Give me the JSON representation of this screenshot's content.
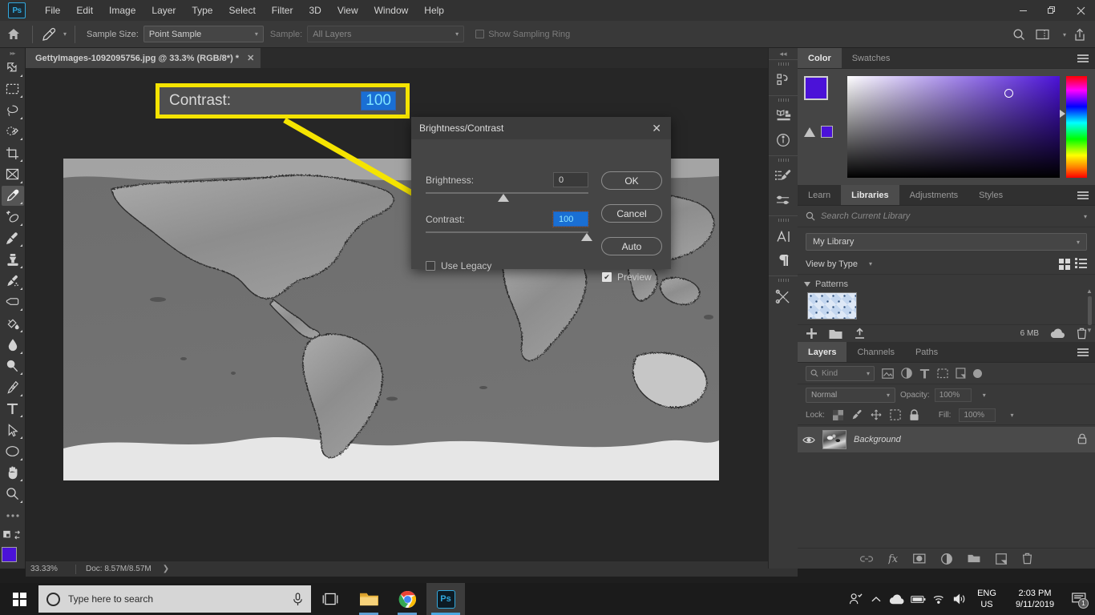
{
  "app": {
    "logo": "Ps",
    "menus": [
      "File",
      "Edit",
      "Image",
      "Layer",
      "Type",
      "Select",
      "Filter",
      "3D",
      "View",
      "Window",
      "Help"
    ],
    "window_controls": {
      "minimize": "—",
      "restore": "❐",
      "close": "✕"
    }
  },
  "options_bar": {
    "home_icon": "home-icon",
    "tool_icon": "eyedropper-icon",
    "sample_size_label": "Sample Size:",
    "sample_size_value": "Point Sample",
    "sample_label": "Sample:",
    "sample_value": "All Layers",
    "show_sampling_ring_label": "Show Sampling Ring",
    "show_sampling_ring_checked": false,
    "right_icons": [
      "search-icon",
      "workspace-icon",
      "share-icon"
    ]
  },
  "toolbar": {
    "tools": [
      {
        "name": "move-tool",
        "glyph": "move"
      },
      {
        "name": "rectangular-marquee-tool",
        "glyph": "marquee"
      },
      {
        "name": "lasso-tool",
        "glyph": "lasso"
      },
      {
        "name": "quick-selection-tool",
        "glyph": "quickselect"
      },
      {
        "name": "crop-tool",
        "glyph": "crop"
      },
      {
        "name": "frame-tool",
        "glyph": "frame"
      },
      {
        "name": "eyedropper-tool",
        "glyph": "eyedropper",
        "active": true
      },
      {
        "name": "spot-healing-brush-tool",
        "glyph": "heal"
      },
      {
        "name": "brush-tool",
        "glyph": "brush"
      },
      {
        "name": "clone-stamp-tool",
        "glyph": "stamp"
      },
      {
        "name": "history-brush-tool",
        "glyph": "historybrush"
      },
      {
        "name": "eraser-tool",
        "glyph": "eraser"
      },
      {
        "name": "gradient-tool",
        "glyph": "bucket"
      },
      {
        "name": "blur-tool",
        "glyph": "drop"
      },
      {
        "name": "dodge-tool",
        "glyph": "dodge"
      },
      {
        "name": "pen-tool",
        "glyph": "pen"
      },
      {
        "name": "type-tool",
        "glyph": "type"
      },
      {
        "name": "path-selection-tool",
        "glyph": "arrow"
      },
      {
        "name": "ellipse-tool",
        "glyph": "ellipse"
      },
      {
        "name": "hand-tool",
        "glyph": "hand"
      },
      {
        "name": "zoom-tool",
        "glyph": "zoom"
      },
      {
        "name": "edit-toolbar-tool",
        "glyph": "dots"
      }
    ],
    "quick_mask_icon": "quick-mask-icon",
    "screen_mode_icon": "screen-mode-icon",
    "foreground_color": "#4b12d8",
    "background_color": "#d9d9d9"
  },
  "document": {
    "tab_title": "GettyImages-1092095756.jpg @ 33.3% (RGB/8*) *",
    "close_glyph": "✕"
  },
  "status_bar": {
    "zoom": "33.33%",
    "doc_info": "Doc: 8.57M/8.57M",
    "arrow": "❯"
  },
  "callout": {
    "label": "Contrast:",
    "value": "100",
    "border_color": "#f5e400"
  },
  "dialog": {
    "title": "Brightness/Contrast",
    "close_glyph": "✕",
    "brightness_label": "Brightness:",
    "brightness_value": "0",
    "contrast_label": "Contrast:",
    "contrast_value": "100",
    "buttons": [
      "OK",
      "Cancel",
      "Auto"
    ],
    "use_legacy_label": "Use Legacy",
    "use_legacy_checked": false,
    "preview_label": "Preview",
    "preview_checked": true,
    "preview_check_glyph": "✔"
  },
  "icon_dock": {
    "collapse_glyph": "◂◂",
    "groups": [
      [
        "history-icon"
      ],
      [
        "properties-icon",
        "info-icon"
      ],
      [
        "brush-presets-icon",
        "brush-settings-icon"
      ],
      [
        "character-icon",
        "paragraph-icon"
      ],
      [
        "tool-presets-icon"
      ]
    ]
  },
  "color_panel": {
    "tabs": [
      {
        "label": "Color",
        "active": true
      },
      {
        "label": "Swatches",
        "active": false
      }
    ],
    "menu_icon": "panel-menu-icon",
    "foreground_color": "#4b12d8",
    "background_color": "#d9d9d9",
    "gamut_warning_icon": "gamut-warning-icon"
  },
  "libraries_panel": {
    "tabs": [
      {
        "label": "Learn",
        "active": false
      },
      {
        "label": "Libraries",
        "active": true
      },
      {
        "label": "Adjustments",
        "active": false
      },
      {
        "label": "Styles",
        "active": false
      }
    ],
    "menu_icon": "panel-menu-icon",
    "search_placeholder": "Search Current Library",
    "search_icon": "search-icon",
    "library_select": "My Library",
    "view_by_label": "View by Type",
    "grid_view_icon": "grid-view-icon",
    "list_view_icon": "list-view-icon",
    "section_title": "Patterns",
    "footer": {
      "add_icon": "add-icon",
      "folder_icon": "folder-icon",
      "upload_icon": "upload-icon",
      "size": "6 MB",
      "cloud_icon": "cloud-icon",
      "delete_icon": "trash-icon"
    }
  },
  "layers_panel": {
    "tabs": [
      {
        "label": "Layers",
        "active": true
      },
      {
        "label": "Channels",
        "active": false
      },
      {
        "label": "Paths",
        "active": false
      }
    ],
    "menu_icon": "panel-menu-icon",
    "filter_kind": "Kind",
    "filter_icons": [
      "filter-image-icon",
      "filter-adjustment-icon",
      "filter-type-icon",
      "filter-shape-icon",
      "filter-smart-icon",
      "filter-toggle-icon"
    ],
    "blend_mode": "Normal",
    "opacity_label": "Opacity:",
    "opacity_value": "100%",
    "lock_label": "Lock:",
    "lock_icons": [
      "lock-transparency-icon",
      "lock-image-icon",
      "lock-position-icon",
      "lock-artboard-icon",
      "lock-all-icon"
    ],
    "fill_label": "Fill:",
    "fill_value": "100%",
    "layers": [
      {
        "name": "Background",
        "visible": true,
        "locked": true,
        "eye_icon": "eye-icon",
        "lock_icon": "lock-icon"
      }
    ],
    "footer_icons": [
      "link-layers-icon",
      "layer-style-icon",
      "layer-mask-icon",
      "new-adjustment-icon",
      "new-group-icon",
      "new-layer-icon",
      "delete-layer-icon"
    ]
  },
  "taskbar": {
    "start_icon": "windows-start-icon",
    "search_placeholder": "Type here to search",
    "cortana_icon": "cortana-circle-icon",
    "mic_icon": "microphone-icon",
    "taskview_icon": "task-view-icon",
    "apps": [
      {
        "name": "file-explorer-icon",
        "label": "File Explorer"
      },
      {
        "name": "chrome-icon",
        "label": "Google Chrome"
      },
      {
        "name": "photoshop-icon",
        "label": "Ps"
      }
    ],
    "tray": {
      "people_icon": "people-icon",
      "chevron_icon": "show-hidden-icons-icon",
      "onedrive_icon": "onedrive-cloud-icon",
      "battery_icon": "battery-icon",
      "network_icon": "wifi-icon",
      "volume_icon": "volume-icon",
      "language_line1": "ENG",
      "language_line2": "US",
      "time": "2:03 PM",
      "date": "9/11/2019",
      "notification_icon": "action-center-icon",
      "notification_count": "1"
    }
  }
}
